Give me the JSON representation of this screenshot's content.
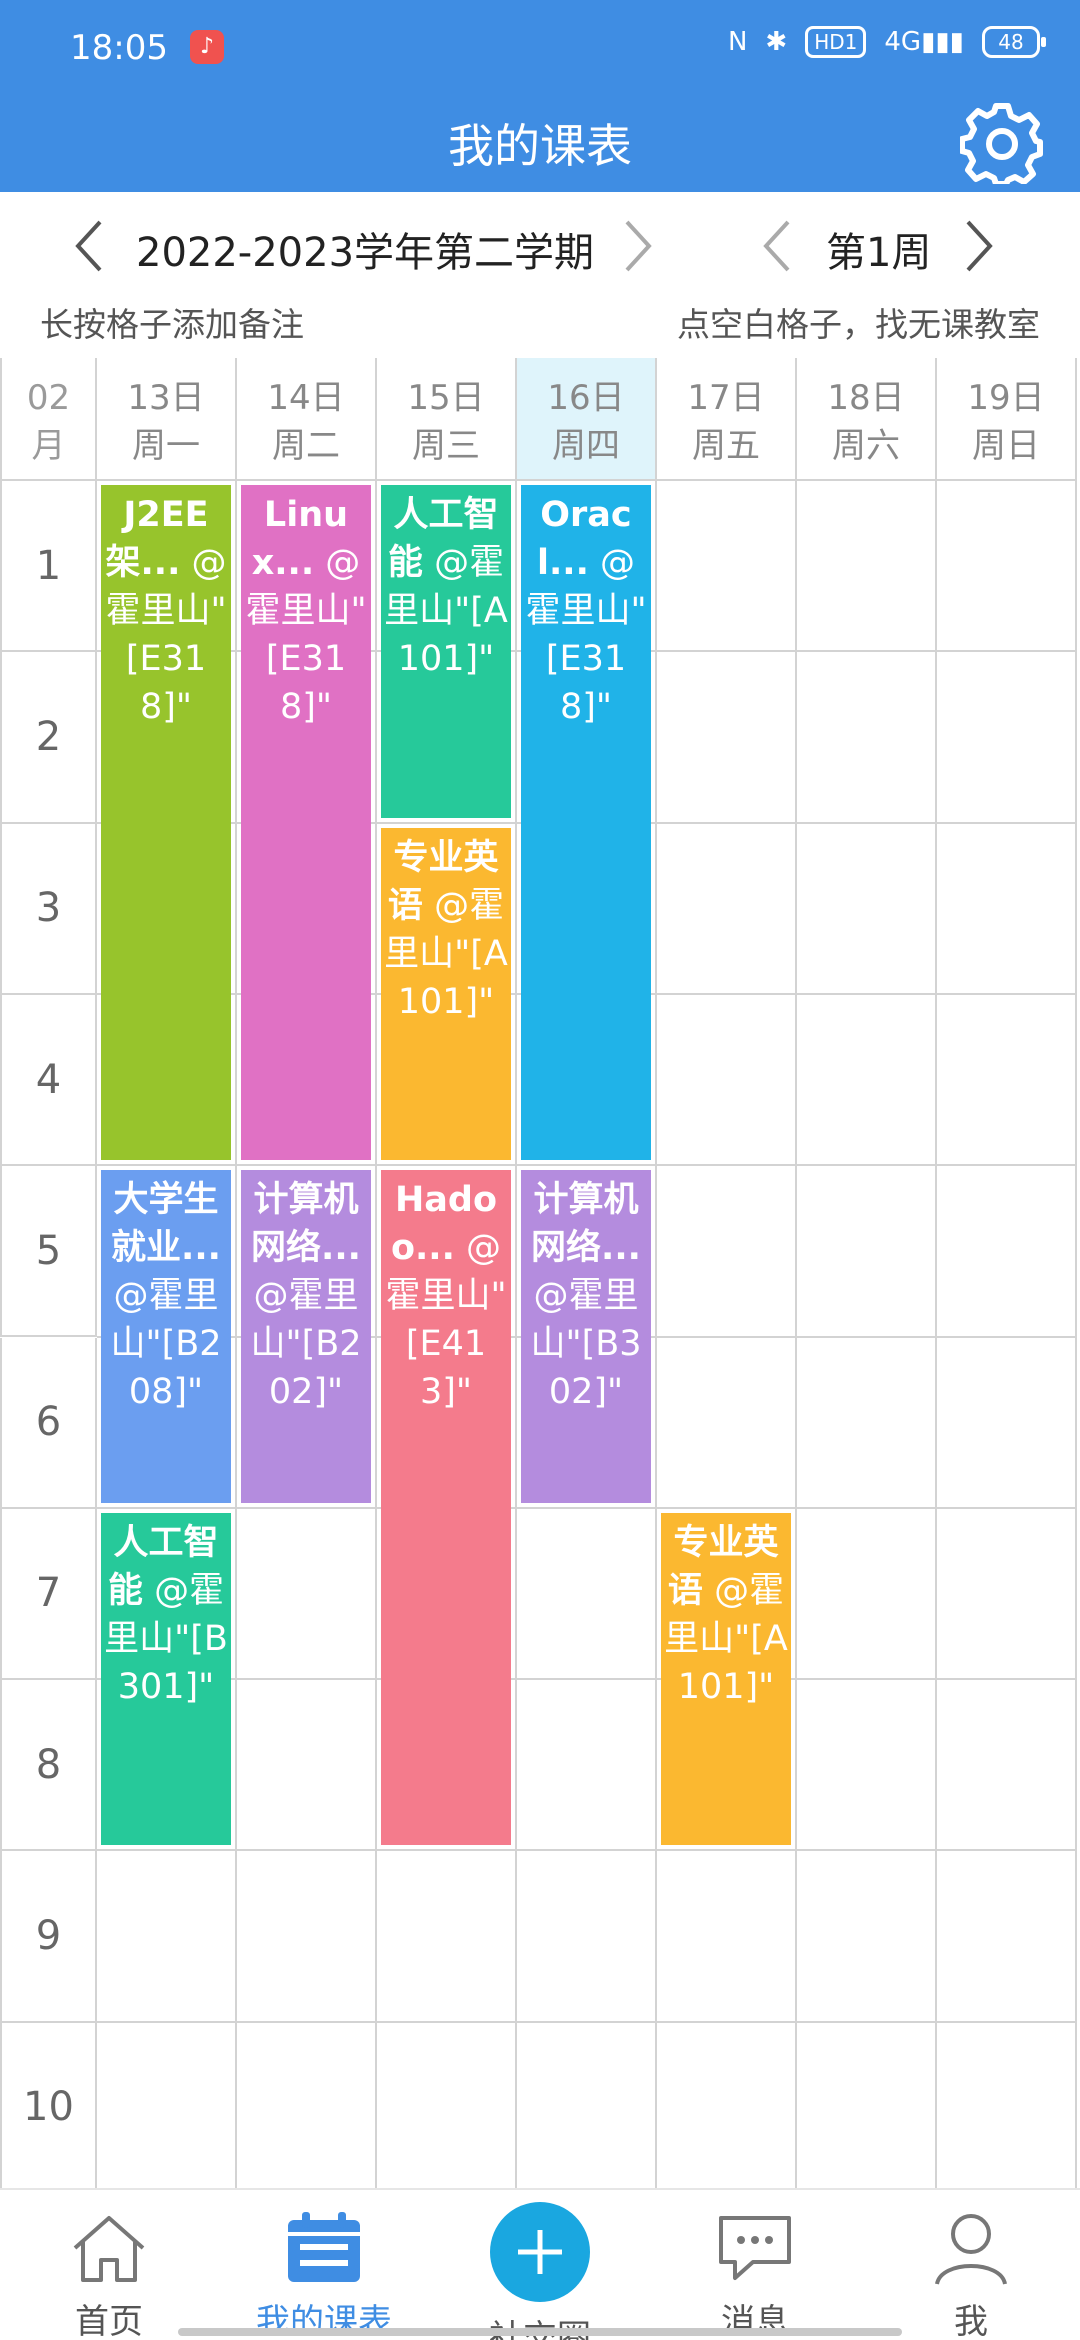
{
  "status_bar": {
    "time": "18:05",
    "network": "4G",
    "hd_label": "HD1",
    "battery": "48"
  },
  "header": {
    "title": "我的课表"
  },
  "semester": {
    "label": "2022-2023学年第二学期",
    "week": "第1周"
  },
  "hints": {
    "left": "长按格子添加备注",
    "right": "点空白格子，找无课教室"
  },
  "month": {
    "num": "02",
    "unit": "月"
  },
  "days": [
    {
      "date": "13日",
      "weekday": "周一",
      "today": false
    },
    {
      "date": "14日",
      "weekday": "周二",
      "today": false
    },
    {
      "date": "15日",
      "weekday": "周三",
      "today": false
    },
    {
      "date": "16日",
      "weekday": "周四",
      "today": true
    },
    {
      "date": "17日",
      "weekday": "周五",
      "today": false
    },
    {
      "date": "18日",
      "weekday": "周六",
      "today": false
    },
    {
      "date": "19日",
      "weekday": "周日",
      "today": false
    }
  ],
  "periods": [
    "1",
    "2",
    "3",
    "4",
    "5",
    "6",
    "7",
    "8",
    "9",
    "10"
  ],
  "courses": [
    {
      "day": 0,
      "start": 1,
      "end": 4,
      "name": "J2EE架...",
      "location": "@霍里山\"[E318]\"",
      "color": "#97c42c"
    },
    {
      "day": 0,
      "start": 5,
      "end": 6,
      "name": "大学生就业...",
      "location": "@霍里山\"[B208]\"",
      "color": "#6b9ef0"
    },
    {
      "day": 0,
      "start": 7,
      "end": 8,
      "name": "人工智能",
      "location": "@霍里山\"[B301]\"",
      "color": "#26c99a"
    },
    {
      "day": 1,
      "start": 1,
      "end": 4,
      "name": "Linux...",
      "location": "@霍里山\"[E318]\"",
      "color": "#e071c4"
    },
    {
      "day": 1,
      "start": 5,
      "end": 6,
      "name": "计算机网络...",
      "location": "@霍里山\"[B202]\"",
      "color": "#b48cde"
    },
    {
      "day": 2,
      "start": 1,
      "end": 2,
      "name": "人工智能",
      "location": "@霍里山\"[A101]\"",
      "color": "#26c99a"
    },
    {
      "day": 2,
      "start": 3,
      "end": 4,
      "name": "专业英语",
      "location": "@霍里山\"[A101]\"",
      "color": "#fbb830"
    },
    {
      "day": 2,
      "start": 5,
      "end": 8,
      "name": "Hadoo...",
      "location": "@霍里山\"[E413]\"",
      "color": "#f47b8c"
    },
    {
      "day": 3,
      "start": 1,
      "end": 4,
      "name": "Oracl...",
      "location": "@霍里山\"[E318]\"",
      "color": "#20b3e8"
    },
    {
      "day": 3,
      "start": 5,
      "end": 6,
      "name": "计算机网络...",
      "location": "@霍里山\"[B302]\"",
      "color": "#b48cde"
    },
    {
      "day": 4,
      "start": 7,
      "end": 8,
      "name": "专业英语",
      "location": "@霍里山\"[A101]\"",
      "color": "#fbb830"
    }
  ],
  "nav": [
    {
      "label": "首页",
      "icon": "home-icon",
      "active": false
    },
    {
      "label": "我的课表",
      "icon": "calendar-icon",
      "active": true
    },
    {
      "label": "社交圈",
      "icon": "add-icon",
      "active": false
    },
    {
      "label": "消息",
      "icon": "chat-icon",
      "active": false
    },
    {
      "label": "我",
      "icon": "person-icon",
      "active": false
    }
  ],
  "colors": {
    "brand": "#3f8de3",
    "today_header": "#dff4fb",
    "add_button": "#1aa7e0"
  }
}
